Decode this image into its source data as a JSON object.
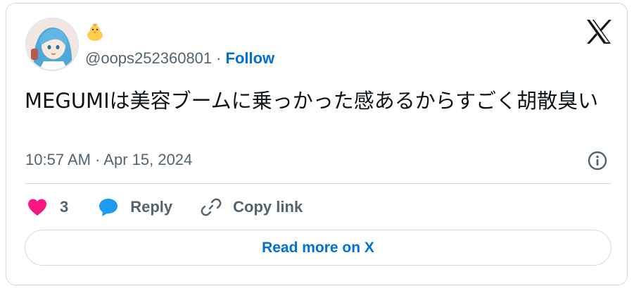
{
  "author": {
    "display_emoji": "🐥",
    "handle": "@oops252360801",
    "separator": "·",
    "follow_label": "Follow"
  },
  "tweet": {
    "text": "MEGUMIは美容ブームに乗っかった感あるからすごく胡散臭い",
    "timestamp": "10:57 AM · Apr 15, 2024"
  },
  "actions": {
    "like_count": "3",
    "reply_label": "Reply",
    "copy_link_label": "Copy link"
  },
  "read_more_label": "Read more on X",
  "icons": {
    "platform": "x-logo-icon",
    "info": "info-icon",
    "like": "heart-icon",
    "reply": "speech-bubble-icon",
    "copy": "link-icon"
  },
  "colors": {
    "accent": "#006fd6",
    "heart": "#f91880",
    "reply_bubble": "#1d9bf0",
    "secondary_text": "#536471",
    "border": "#cfd9de"
  }
}
